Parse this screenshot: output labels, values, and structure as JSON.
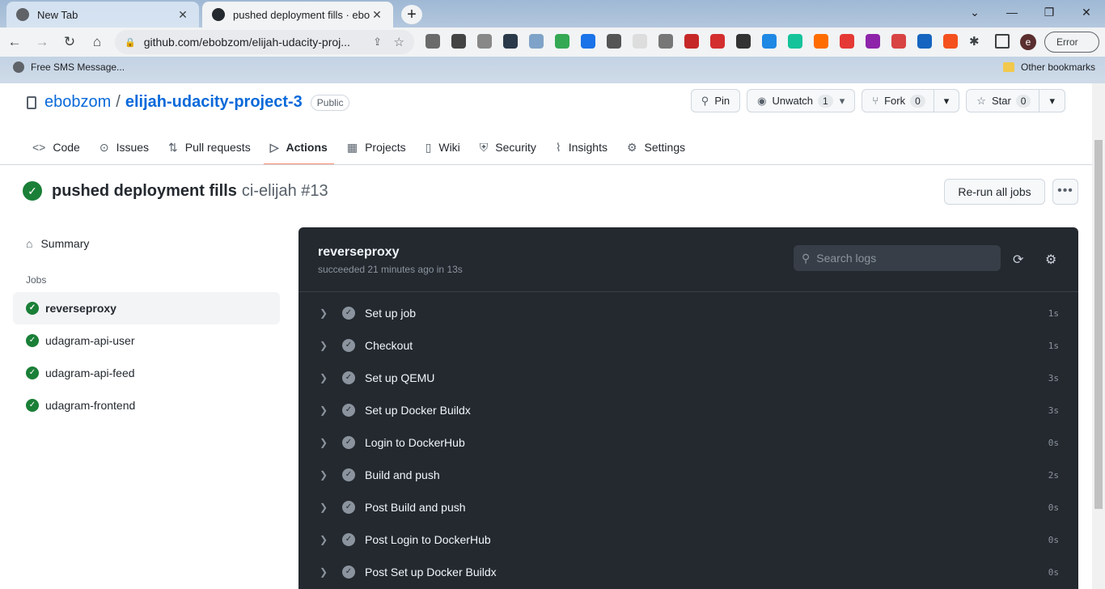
{
  "browser": {
    "tabs": [
      {
        "title": "New Tab",
        "active": false
      },
      {
        "title": "pushed deployment fills · ebobzo",
        "active": true
      }
    ],
    "url": "github.com/ebobzom/elijah-udacity-proj...",
    "profile_initial": "e",
    "error_label": "Error",
    "bookmarks": {
      "first": "Free SMS Message...",
      "other": "Other bookmarks"
    }
  },
  "repo": {
    "owner": "ebobzom",
    "separator": "/",
    "name": "elijah-udacity-project-3",
    "visibility": "Public",
    "pin_label": "Pin",
    "unwatch_label": "Unwatch",
    "unwatch_count": "1",
    "fork_label": "Fork",
    "fork_count": "0",
    "star_label": "Star",
    "star_count": "0"
  },
  "nav": [
    {
      "label": "Code",
      "icon": "code-icon"
    },
    {
      "label": "Issues",
      "icon": "issue-icon"
    },
    {
      "label": "Pull requests",
      "icon": "pull-request-icon"
    },
    {
      "label": "Actions",
      "icon": "play-icon"
    },
    {
      "label": "Projects",
      "icon": "table-icon"
    },
    {
      "label": "Wiki",
      "icon": "book-icon"
    },
    {
      "label": "Security",
      "icon": "shield-icon"
    },
    {
      "label": "Insights",
      "icon": "graph-icon"
    },
    {
      "label": "Settings",
      "icon": "gear-icon"
    }
  ],
  "run": {
    "title": "pushed deployment fills",
    "workflow": "ci-elijah #13",
    "rerun_label": "Re-run all jobs"
  },
  "sidebar": {
    "summary": "Summary",
    "jobs_label": "Jobs",
    "jobs": [
      "reverseproxy",
      "udagram-api-user",
      "udagram-api-feed",
      "udagram-frontend"
    ]
  },
  "log": {
    "job_title": "reverseproxy",
    "status": "succeeded 21 minutes ago in 13s",
    "search_placeholder": "Search logs",
    "steps": [
      {
        "name": "Set up job",
        "duration": "1s"
      },
      {
        "name": "Checkout",
        "duration": "1s"
      },
      {
        "name": "Set up QEMU",
        "duration": "3s"
      },
      {
        "name": "Set up Docker Buildx",
        "duration": "3s"
      },
      {
        "name": "Login to DockerHub",
        "duration": "0s"
      },
      {
        "name": "Build and push",
        "duration": "2s"
      },
      {
        "name": "Post Build and push",
        "duration": "0s"
      },
      {
        "name": "Post Login to DockerHub",
        "duration": "0s"
      },
      {
        "name": "Post Set up Docker Buildx",
        "duration": "0s"
      }
    ]
  },
  "colors": {
    "success": "#1a7f37",
    "link": "#0969da",
    "log_bg": "#24292f",
    "nav_underline": "#fd8c73"
  }
}
